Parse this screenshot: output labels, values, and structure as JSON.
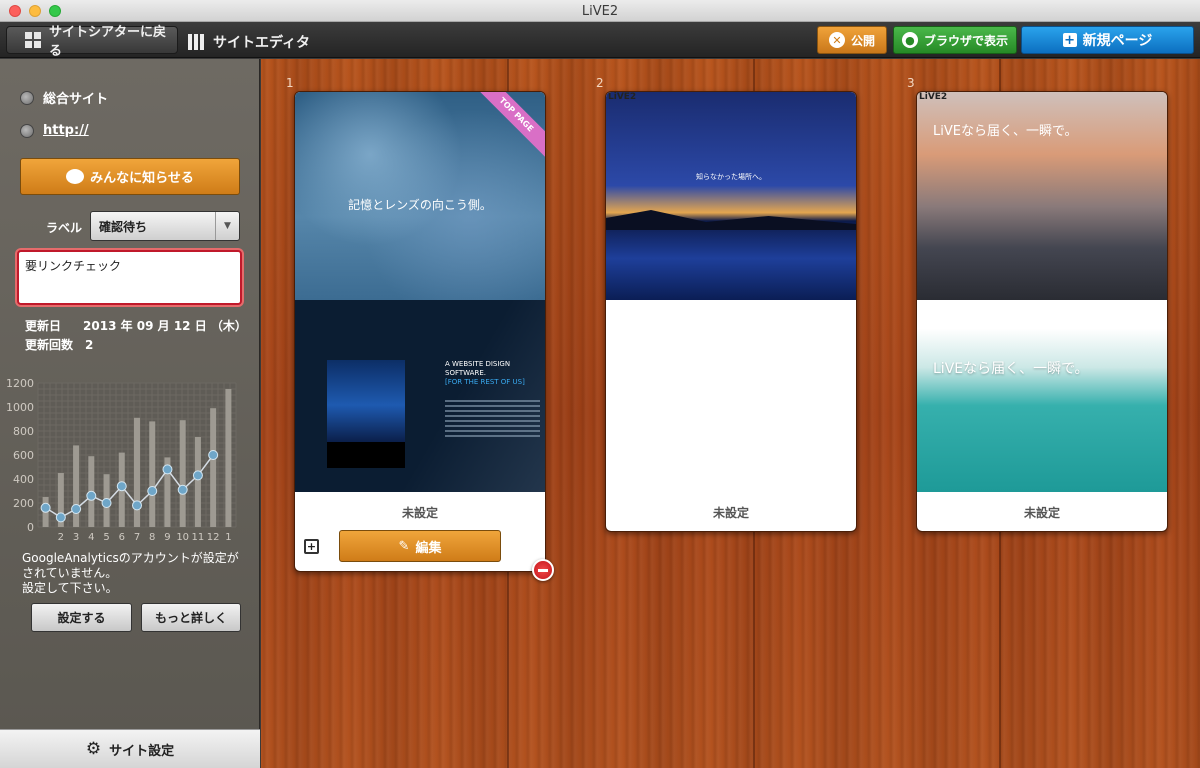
{
  "window": {
    "title": "LiVE2"
  },
  "toolbar": {
    "back_label": "サイトシアターに戻る",
    "editor_label": "サイトエディタ",
    "publish_label": "公開",
    "browser_label": "ブラウザで表示",
    "new_page_label": "新規ページ"
  },
  "sidebar": {
    "site_name": "総合サイト",
    "url": "http://",
    "notify_label": "みんなに知らせる",
    "label_caption": "ラベル",
    "label_value": "確認待ち",
    "memo": "要リンクチェック",
    "updated_label": "更新日",
    "updated_value": "2013 年 09 月 12 日 （木）",
    "revisions_label": "更新回数",
    "revisions_value": "2",
    "ga_note": "GoogleAnalyticsのアカウントが設定がされていません。\n設定して下さい。",
    "set_label": "設定する",
    "more_label": "もっと詳しく",
    "site_settings_label": "サイト設定"
  },
  "chart_data": {
    "type": "bar",
    "y_ticks": [
      "1200",
      "1000",
      "800",
      "600",
      "400",
      "200",
      "0"
    ],
    "x_ticks": [
      "2",
      "3",
      "4",
      "5",
      "6",
      "7",
      "8",
      "9",
      "10",
      "11",
      "12",
      "1"
    ],
    "categories": [
      "1",
      "2",
      "3",
      "4",
      "5",
      "6",
      "7",
      "8",
      "9",
      "10",
      "11",
      "12",
      "1"
    ],
    "ylim": [
      0,
      1200
    ],
    "series": [
      {
        "values": [
          250,
          450,
          680,
          590,
          440,
          620,
          910,
          880,
          580,
          890,
          750,
          990,
          1150
        ]
      },
      {
        "values": [
          160,
          80,
          150,
          260,
          200,
          340,
          180,
          300,
          480,
          310,
          430,
          600
        ]
      }
    ]
  },
  "pages": [
    {
      "number": "1",
      "status": "未設定",
      "badge": "TOP PAGE",
      "heading": "記憶とレンズの向こう側。",
      "caption1": "A WEBSITE DISIGN SOFTWARE.",
      "caption2": "[FOR THE REST OF US]",
      "edit_label": "編集"
    },
    {
      "number": "2",
      "status": "未設定",
      "logo": "LiVE2",
      "heading": "知らなかった場所へ。"
    },
    {
      "number": "3",
      "status": "未設定",
      "logo": "LiVE2",
      "heading": "LiVEなら届く、一瞬で。",
      "heading2": "LiVEなら届く、一瞬で。"
    }
  ],
  "colors": {
    "accent_orange": "#cf7c18",
    "accent_green": "#268a26",
    "accent_blue": "#0c6fc0",
    "alert_red": "#c0192b"
  }
}
